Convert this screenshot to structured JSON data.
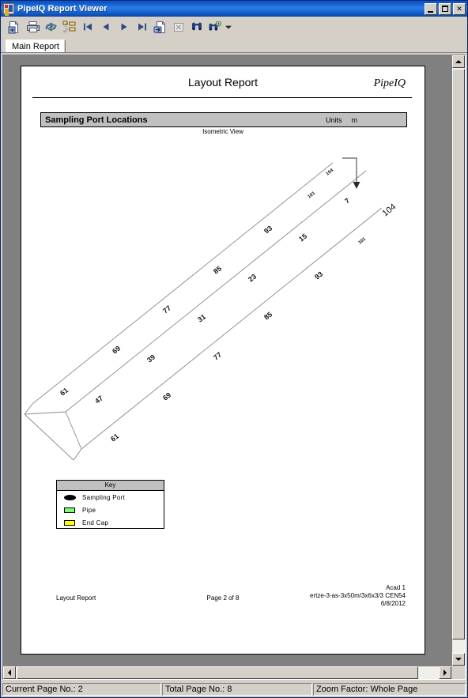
{
  "window": {
    "title": "PipeIQ Report Viewer",
    "app_icon": "pipeiq-app-icon",
    "buttons": {
      "minimize": "minimize-button",
      "maximize": "maximize-button",
      "close": "close-button",
      "close_glyph": "✕"
    }
  },
  "toolbar": {
    "items": [
      {
        "name": "export-report-icon",
        "tip": "Export Report"
      },
      {
        "name": "print-report-icon",
        "tip": "Print Report"
      },
      {
        "name": "refresh-icon",
        "tip": "Refresh"
      },
      {
        "name": "toggle-group-tree-icon",
        "tip": "Toggle Group Tree"
      },
      {
        "name": "first-page-icon",
        "tip": "Go To First Page"
      },
      {
        "name": "previous-page-icon",
        "tip": "Go To Previous Page"
      },
      {
        "name": "next-page-icon",
        "tip": "Go To Next Page"
      },
      {
        "name": "last-page-icon",
        "tip": "Go To Last Page"
      },
      {
        "name": "go-to-page-icon",
        "tip": "Go To Page"
      },
      {
        "name": "close-current-view-icon",
        "tip": "Close Current View"
      },
      {
        "name": "search-text-icon",
        "tip": "Search Text"
      },
      {
        "name": "zoom-icon",
        "tip": "Zoom"
      },
      {
        "name": "chevron-down-icon",
        "tip": "Zoom Options"
      }
    ]
  },
  "tabs": {
    "active": "Main Report",
    "items": [
      {
        "label": "Main Report"
      }
    ]
  },
  "report": {
    "title": "Layout Report",
    "logo": "PipeIQ",
    "band": {
      "title": "Sampling Port Locations",
      "units_label": "Units",
      "units_value": "m"
    },
    "subcaption": "Isometric View",
    "key": {
      "header": "Key",
      "rows": [
        {
          "swatch": "sampling-port-swatch",
          "label": "Sampling Port",
          "color": "#000000"
        },
        {
          "swatch": "pipe-swatch",
          "label": "Pipe",
          "color": "#7aff7a"
        },
        {
          "swatch": "end-cap-swatch",
          "label": "End Cap",
          "color": "#ffff00"
        }
      ]
    },
    "footer": {
      "left": "Layout Report",
      "center": "Page 2 of 8",
      "right_line1": "Acad 1",
      "right_line2": "ertze-3-as-3x50m/3x6x3/3 CEN54",
      "right_line3": "6/8/2012"
    }
  },
  "chart_data": {
    "type": "diagram",
    "title": "Sampling Port Locations",
    "subtitle": "Isometric View",
    "units": "m",
    "view": "isometric",
    "lines": [
      {
        "name": "pipe-line-top",
        "start": [
          72,
          426
        ],
        "end": [
          452,
          121
        ],
        "labels": [
          "61",
          "69",
          "77",
          "85",
          "93",
          "101",
          "104"
        ],
        "end_labels": [
          "101",
          "104"
        ]
      },
      {
        "name": "pipe-line-middle",
        "start": [
          112,
          434
        ],
        "end": [
          492,
          129
        ],
        "labels": [
          "47",
          "39",
          "31",
          "23",
          "15",
          "7"
        ],
        "end_labels": [
          "7"
        ]
      },
      {
        "name": "pipe-line-bottom",
        "start": [
          130,
          482
        ],
        "end": [
          510,
          177
        ],
        "labels": [
          "61",
          "69",
          "77",
          "85",
          "93",
          "101",
          "104"
        ],
        "end_labels": [
          "101",
          "104"
        ]
      }
    ],
    "annotations": [
      {
        "name": "flow-arrow",
        "direction": "down"
      }
    ]
  },
  "statusbar": {
    "current_page": "Current Page No.: 2",
    "total_page": "Total Page No.: 8",
    "zoom_factor": "Zoom Factor: Whole Page"
  },
  "scrollbars": {
    "vertical": "vertical-scrollbar",
    "horizontal": "horizontal-scrollbar"
  }
}
